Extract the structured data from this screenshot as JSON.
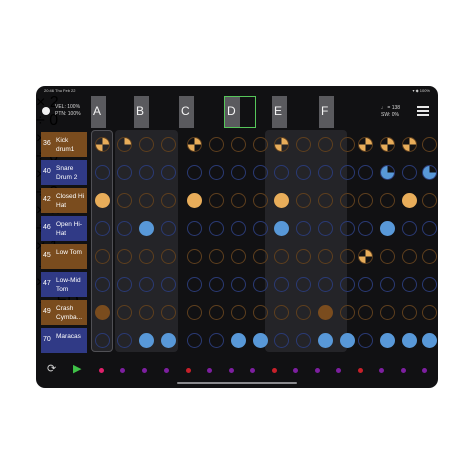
{
  "status": {
    "time": "20:46  Thu Feb 22",
    "indicators": "▾ ◆ 100%"
  },
  "header": {
    "vel_label": "VEL: 100%",
    "ptn_label": "PTN: 100%",
    "tempo": "♩ = 138",
    "swing": "SW: 0%"
  },
  "patterns": [
    {
      "letter": "A",
      "line1": "× 2",
      "line2": "÷ 0"
    },
    {
      "letter": "B",
      "line1": "× ∞",
      "line2": "÷ 0"
    },
    {
      "letter": "C",
      "line1": "× ∞",
      "line2": "÷ 0"
    },
    {
      "letter": "D",
      "line1": "× ∞",
      "line2": "÷ 0"
    },
    {
      "letter": "E",
      "line1": "× 1",
      "line2": "→ D"
    },
    {
      "letter": "F",
      "line1": "× 2",
      "line2": "→ ED"
    }
  ],
  "selected_pattern": "D",
  "tracks": [
    {
      "num": "36",
      "name": "Kick drum1",
      "color": "#7a4c1e"
    },
    {
      "num": "40",
      "name": "Snare Drum 2",
      "color": "#303a86"
    },
    {
      "num": "42",
      "name": "Closed Hi Hat",
      "color": "#7a4c1e"
    },
    {
      "num": "46",
      "name": "Open Hi-Hat",
      "color": "#303a86"
    },
    {
      "num": "45",
      "name": "Low Tom",
      "color": "#7a4c1e"
    },
    {
      "num": "47",
      "name": "Low-Mid Tom",
      "color": "#303a86"
    },
    {
      "num": "49",
      "name": "Crash Cymba...",
      "color": "#7a4c1e"
    },
    {
      "num": "70",
      "name": "Maracas",
      "color": "#303a86"
    }
  ],
  "step_grid": [
    "QE..Q...Q...QQQ.",
    ".............P.P",
    "F...F...F.....F.",
    "..B.....B....B..",
    "............Q...",
    "................",
    "D.........D.....",
    "..BB..BB..BB.BBB"
  ],
  "colors": {
    "orange": "#e8ad5a",
    "blue": "#5898d8",
    "dark_orange": "#7a4c1e",
    "empty_orange": "#5e3f1e",
    "empty_blue": "#2a3a74",
    "accent_green": "#56c65a"
  },
  "pattern_dot_colors": [
    "#e0206a",
    "#7d1fa0",
    "#7d1fa0",
    "#7d1fa0",
    "#c8202a",
    "#7d1fa0",
    "#7d1fa0",
    "#7d1fa0",
    "#c8202a",
    "#7d1fa0",
    "#7d1fa0",
    "#7d1fa0",
    "#c8202a",
    "#7d1fa0",
    "#7d1fa0",
    "#7d1fa0"
  ],
  "icons": {
    "loop": "loop-icon",
    "play": "play-icon",
    "menu": "menu-icon"
  }
}
